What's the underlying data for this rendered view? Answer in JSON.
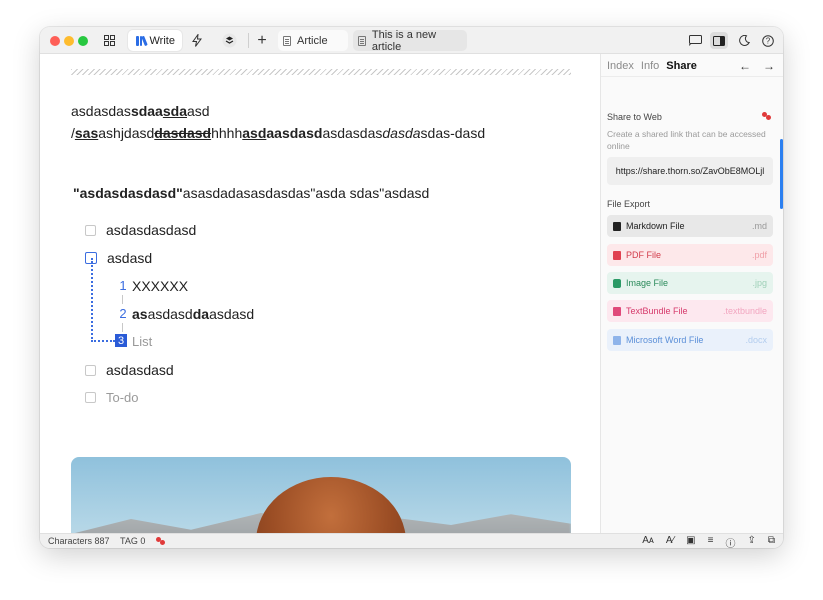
{
  "toolbar": {
    "write_label": "Write",
    "tabs": [
      {
        "label": "Article"
      },
      {
        "label": "This is a new article"
      }
    ],
    "icons": [
      "grid-icon",
      "bolt-icon",
      "layers-icon",
      "plus-icon",
      "cast-icon",
      "sidebar-icon",
      "moon-icon",
      "help-icon"
    ]
  },
  "editor": {
    "paragraph": [
      {
        "text": "asdasdas",
        "style": ""
      },
      {
        "text": "sdaa",
        "style": "bold"
      },
      {
        "text": "sda",
        "style": "bold-underline"
      },
      {
        "text": "asd /",
        "style": ""
      },
      {
        "text": "sas",
        "style": "bold-underline"
      },
      {
        "text": "ashjdasd",
        "style": ""
      },
      {
        "text": "dasdasd",
        "style": "bold-strike"
      },
      {
        "text": "hhhh",
        "style": ""
      },
      {
        "text": "asd",
        "style": "bold-underline"
      },
      {
        "text": "aasdasd",
        "style": "bold"
      },
      {
        "text": "asdasdas",
        "style": ""
      },
      {
        "text": "dasda",
        "style": "italic"
      },
      {
        "text": "sdas-dasd",
        "style": ""
      }
    ],
    "quote": {
      "bold": "\"asdasdasdasd\"",
      "rest": "asasdadasasdasdas\"asda sdas\"asdasd"
    },
    "todos_top": [
      "asdasdasdasd",
      "asdasd"
    ],
    "numbered": [
      {
        "num": "1",
        "parts": [
          {
            "text": "XXXXXX",
            "bold": false
          }
        ]
      },
      {
        "num": "2",
        "parts": [
          {
            "text": "as",
            "bold": true
          },
          {
            "text": "asdasd",
            "bold": false
          },
          {
            "text": "da",
            "bold": true
          },
          {
            "text": "asdasd",
            "bold": false
          }
        ]
      },
      {
        "num": "3",
        "parts": [
          {
            "text": "List",
            "bold": false
          }
        ]
      }
    ],
    "todos_bottom": [
      "asdasdasd"
    ],
    "todo_placeholder": "To-do"
  },
  "sidebar": {
    "tabs": [
      "Index",
      "Info",
      "Share"
    ],
    "active_tab": "Share",
    "share_title": "Share to Web",
    "share_desc": "Create a shared link that can be accessed online",
    "share_link": "https://share.thorn.so/ZavObE8MOLjl",
    "export_title": "File Export",
    "exports": [
      {
        "label": "Markdown File",
        "ext": ".md"
      },
      {
        "label": "PDF File",
        "ext": ".pdf"
      },
      {
        "label": "Image File",
        "ext": ".jpg"
      },
      {
        "label": "TextBundle File",
        "ext": ".textbundle"
      },
      {
        "label": "Microsoft Word File",
        "ext": ".docx"
      }
    ]
  },
  "status": {
    "characters": "Characters 887",
    "tag": "TAG 0",
    "icons": [
      "font-size-icon",
      "font-style-icon",
      "image-icon",
      "align-icon",
      "info-icon",
      "export-icon",
      "copy-icon"
    ]
  },
  "colors": {
    "accent": "#2b6de5",
    "share_red": "#e03a3a"
  }
}
